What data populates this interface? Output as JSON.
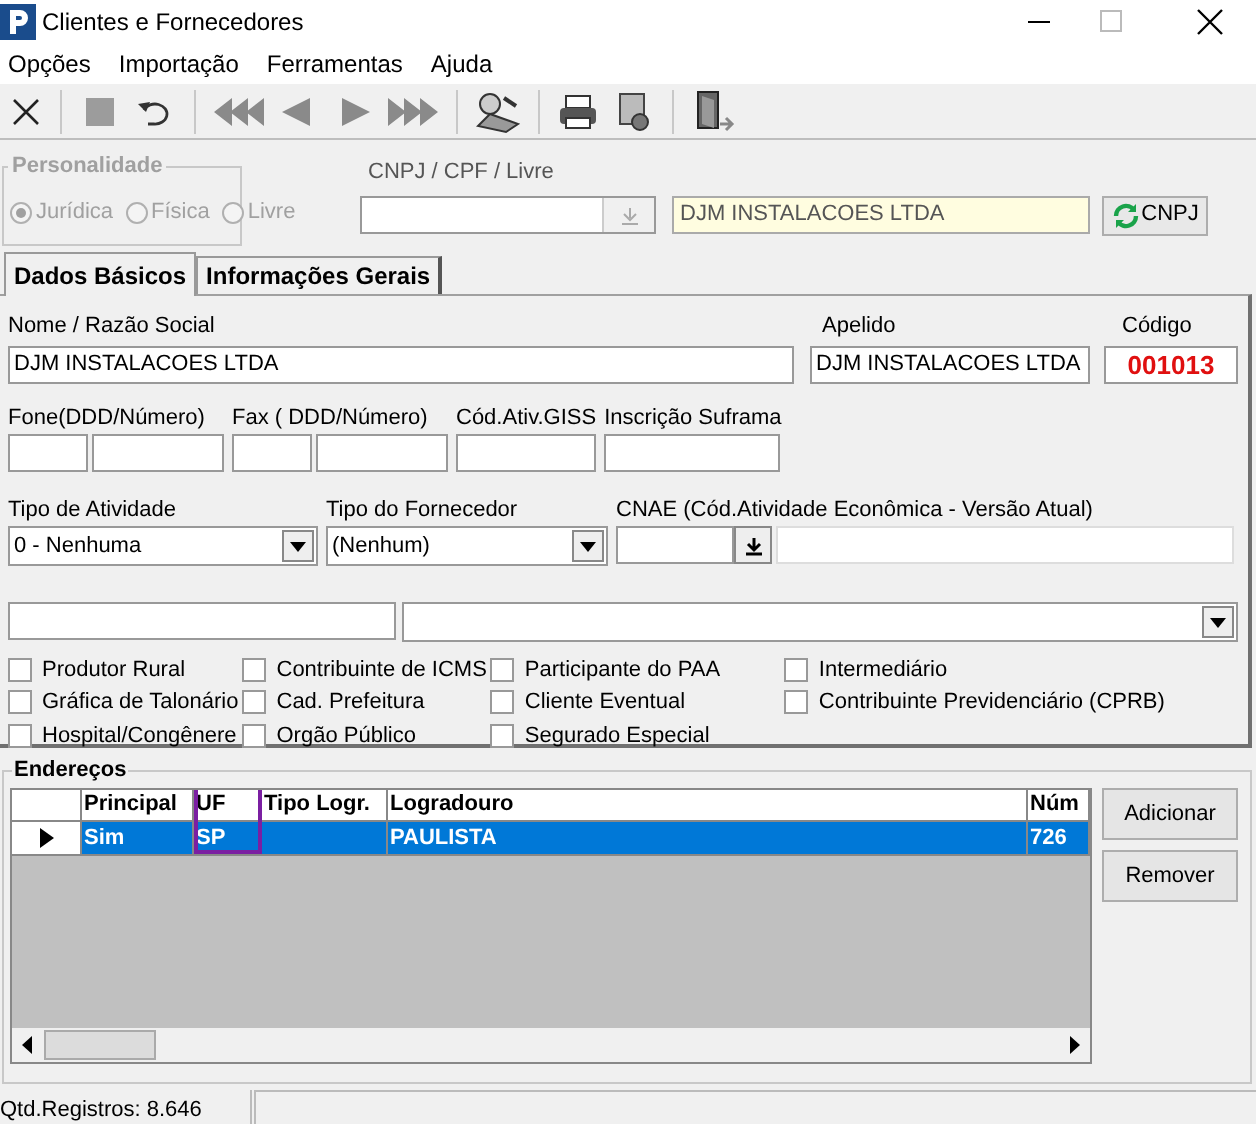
{
  "window": {
    "title": "Clientes e Fornecedores"
  },
  "menu": [
    "Opções",
    "Importação",
    "Ferramentas",
    "Ajuda"
  ],
  "personalidade": {
    "title": "Personalidade",
    "disabled": true,
    "options": [
      {
        "label": "Jurídica",
        "selected": true
      },
      {
        "label": "Física",
        "selected": false
      },
      {
        "label": "Livre",
        "selected": false
      }
    ]
  },
  "document": {
    "label": "CNPJ / CPF / Livre",
    "name_value": "DJM INSTALACOES LTDA",
    "button": "CNPJ"
  },
  "tabs": [
    {
      "label": "Dados Básicos",
      "selected": true
    },
    {
      "label": "Informações Gerais",
      "selected": false
    }
  ],
  "nome": {
    "label": "Nome / Razão Social",
    "value": "DJM INSTALACOES LTDA"
  },
  "apelido": {
    "label": "Apelido",
    "value": "DJM INSTALACOES LTDA"
  },
  "codigo": {
    "label": "Código",
    "value": "001013"
  },
  "contact_labels": [
    "Fone(DDD/Número)",
    "Fax ( DDD/Número)",
    "Cód.Ativ.GISS",
    "Inscrição Suframa"
  ],
  "tipo_atividade": {
    "label": "Tipo de Atividade",
    "value": "0 - Nenhuma"
  },
  "tipo_fornecedor": {
    "label": "Tipo do Fornecedor",
    "value": "(Nenhum)"
  },
  "cnae": {
    "label": "CNAE (Cód.Atividade Econômica - Versão Atual)"
  },
  "checkbox_columns": [
    [
      {
        "label": "Produtor Rural",
        "checked": false
      },
      {
        "label": "Gráfica de Talonário",
        "checked": false
      },
      {
        "label": "Hospital/Congênere",
        "checked": false
      }
    ],
    [
      {
        "label": "Contribuinte de ICMS",
        "checked": false
      },
      {
        "label": "Cad. Prefeitura",
        "checked": false
      },
      {
        "label": "Orgão Público",
        "checked": false
      }
    ],
    [
      {
        "label": "Participante do PAA",
        "checked": false
      },
      {
        "label": "Cliente Eventual",
        "checked": false
      },
      {
        "label": "Segurado Especial",
        "checked": false
      }
    ],
    [
      {
        "label": "Intermediário",
        "checked": false
      },
      {
        "label": "Contribuinte Previdenciário (CPRB)",
        "checked": false
      }
    ]
  ],
  "enderecos": {
    "title": "Endereços",
    "columns": [
      {
        "label": "Principal",
        "highlight": false
      },
      {
        "label": "UF",
        "highlight": true
      },
      {
        "label": "Tipo Logr.",
        "highlight": false
      },
      {
        "label": "Logradouro",
        "highlight": false
      },
      {
        "label": "Núm",
        "highlight": false
      }
    ],
    "rows": [
      {
        "selected": true,
        "cells": [
          "Sim",
          "SP",
          null,
          "PAULISTA",
          "726"
        ]
      }
    ],
    "buttons": [
      "Adicionar",
      "Remover"
    ]
  },
  "status_bar": {
    "records": "Qtd.Registros: 8.646"
  }
}
